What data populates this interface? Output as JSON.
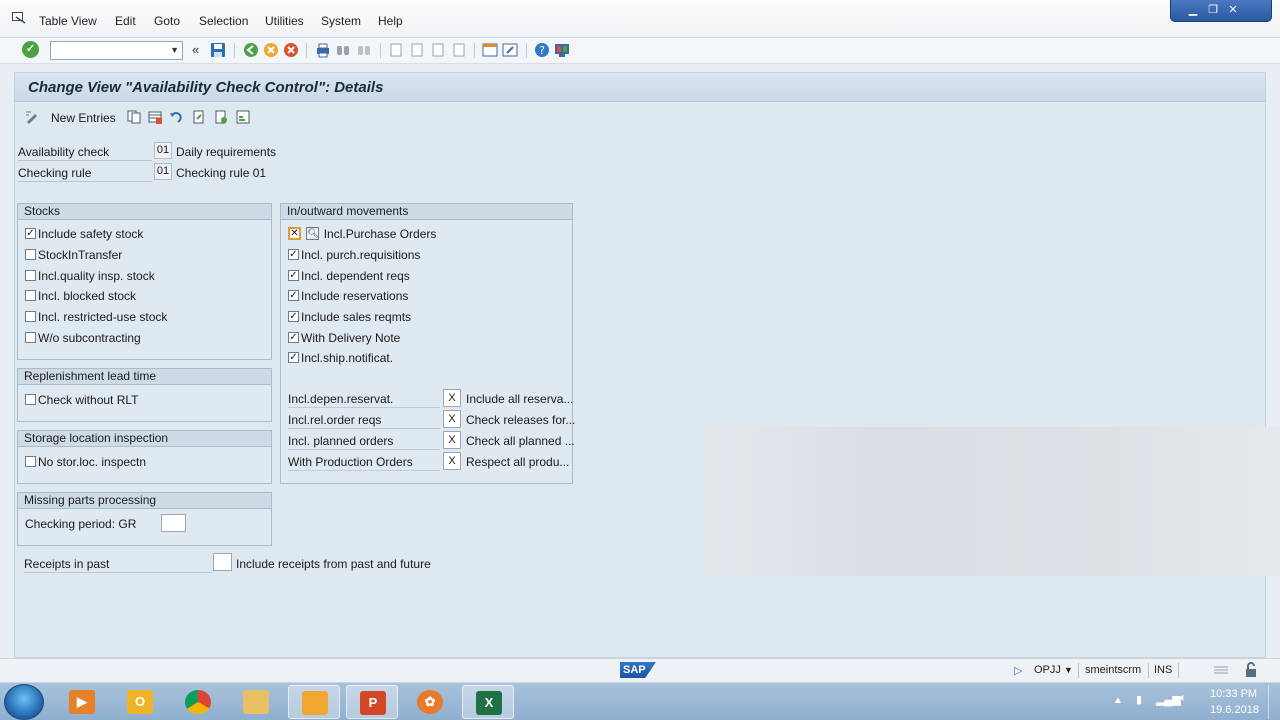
{
  "menu": {
    "items": [
      "Table View",
      "Edit",
      "Goto",
      "Selection",
      "Utilities",
      "System",
      "Help"
    ]
  },
  "toolbar": {
    "command_value": ""
  },
  "title": "Change View \"Availability Check Control\": Details",
  "app_toolbar": {
    "new_entries": "New Entries"
  },
  "keys": [
    {
      "label": "Availability check",
      "code": "01",
      "text": "Daily requirements"
    },
    {
      "label": "Checking rule",
      "code": "01",
      "text": "Checking rule 01"
    }
  ],
  "stocks": {
    "title": "Stocks",
    "items": [
      {
        "label": "Include safety stock",
        "checked": true
      },
      {
        "label": "StockInTransfer",
        "checked": false
      },
      {
        "label": "Incl.quality insp. stock",
        "checked": false
      },
      {
        "label": "Incl. blocked stock",
        "checked": false
      },
      {
        "label": "Incl. restricted-use stock",
        "checked": false
      },
      {
        "label": "W/o subcontracting",
        "checked": false
      }
    ]
  },
  "replenishment": {
    "title": "Replenishment lead time",
    "item": {
      "label": "Check without RLT",
      "checked": false
    }
  },
  "storage": {
    "title": "Storage location inspection",
    "item": {
      "label": "No stor.loc. inspectn",
      "checked": false
    }
  },
  "missing": {
    "title": "Missing parts processing",
    "label": "Checking period: GR",
    "value": ""
  },
  "receipts": {
    "label": "Receipts in past",
    "value": "",
    "text": "Include receipts from past and future"
  },
  "movements": {
    "title": "In/outward movements",
    "items": [
      {
        "label": "Incl.Purchase Orders",
        "checked": true
      },
      {
        "label": "Incl. purch.requisitions",
        "checked": true
      },
      {
        "label": "Incl. dependent reqs",
        "checked": true
      },
      {
        "label": "Include reservations",
        "checked": true
      },
      {
        "label": "Include sales reqmts",
        "checked": true
      },
      {
        "label": "With Delivery Note",
        "checked": true
      },
      {
        "label": "Incl.ship.notificat.",
        "checked": true
      }
    ],
    "rows": [
      {
        "label": "Incl.depen.reservat.",
        "value": "X",
        "text": "Include all reserva..."
      },
      {
        "label": "Incl.rel.order reqs",
        "value": "X",
        "text": "Check releases for..."
      },
      {
        "label": "Incl. planned orders",
        "value": "X",
        "text": "Check all planned ..."
      },
      {
        "label": "With Production Orders",
        "value": "X",
        "text": "Respect all produ..."
      }
    ]
  },
  "status": {
    "logo": "SAP",
    "tcode": "OPJJ",
    "server": "smeintscrm",
    "mode": "INS"
  },
  "taskbar": {
    "time": "10:33 PM",
    "date": "19.6.2018"
  },
  "colors": {
    "accent": "#1a55a0",
    "background": "#dde8f1",
    "group_header": "#cedbe7"
  }
}
